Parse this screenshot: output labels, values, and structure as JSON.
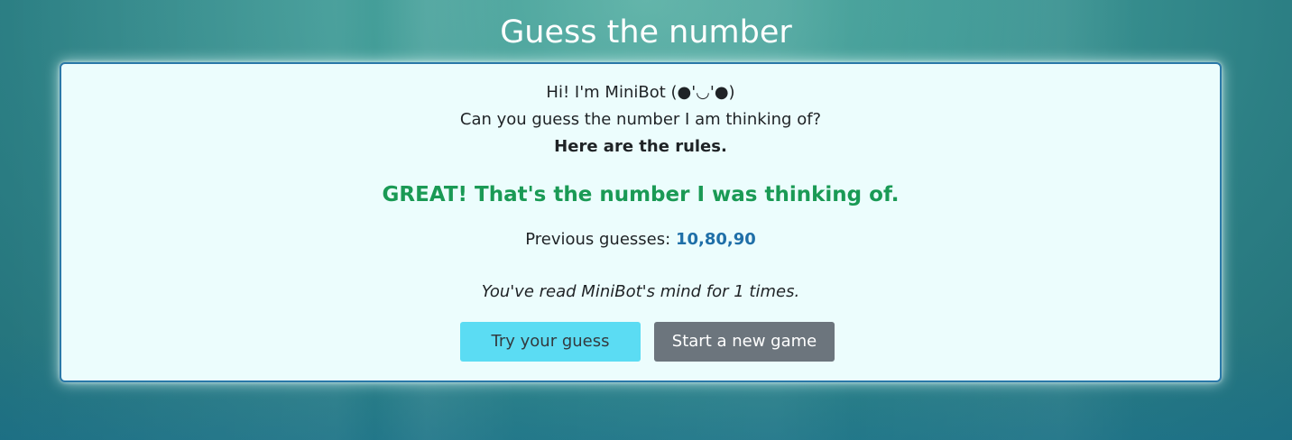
{
  "page": {
    "title": "Guess the number"
  },
  "card": {
    "intro_line1": "Hi! I'm MiniBot (●'◡'●)",
    "intro_line2": "Can you guess the number I am thinking of?",
    "rules_link": "Here are the rules.",
    "result_message": "GREAT! That's the number I was thinking of.",
    "previous_label": "Previous guesses:",
    "previous_guesses": "10,80,90",
    "score_text": "You've read MiniBot's mind for 1 times.",
    "buttons": {
      "try_guess": "Try your guess",
      "new_game": "Start a new game"
    }
  },
  "colors": {
    "success": "#1a9a55",
    "guesses": "#1f6fa8",
    "button_info": "#5bdcf3",
    "button_secondary": "#6c757d",
    "card_border": "#2a78a8"
  }
}
